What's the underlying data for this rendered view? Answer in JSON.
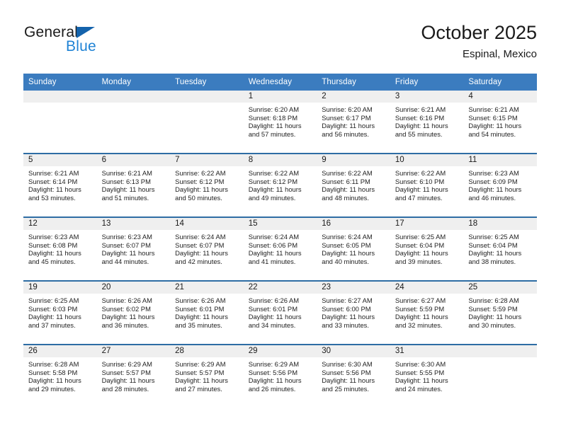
{
  "brand": {
    "name_part1": "General",
    "name_part2": "Blue",
    "triangle_color": "#1463ac",
    "blue_color": "#2083d5"
  },
  "header": {
    "title": "October 2025",
    "location": "Espinal, Mexico"
  },
  "theme": {
    "header_bg": "#3b7cbf",
    "row_divider": "#2e6da4",
    "daynum_bg": "#efefef"
  },
  "weekdays": [
    "Sunday",
    "Monday",
    "Tuesday",
    "Wednesday",
    "Thursday",
    "Friday",
    "Saturday"
  ],
  "weeks": [
    [
      {
        "day": "",
        "sunrise": "",
        "sunset": "",
        "daylight1": "",
        "daylight2": ""
      },
      {
        "day": "",
        "sunrise": "",
        "sunset": "",
        "daylight1": "",
        "daylight2": ""
      },
      {
        "day": "",
        "sunrise": "",
        "sunset": "",
        "daylight1": "",
        "daylight2": ""
      },
      {
        "day": "1",
        "sunrise": "Sunrise: 6:20 AM",
        "sunset": "Sunset: 6:18 PM",
        "daylight1": "Daylight: 11 hours",
        "daylight2": "and 57 minutes."
      },
      {
        "day": "2",
        "sunrise": "Sunrise: 6:20 AM",
        "sunset": "Sunset: 6:17 PM",
        "daylight1": "Daylight: 11 hours",
        "daylight2": "and 56 minutes."
      },
      {
        "day": "3",
        "sunrise": "Sunrise: 6:21 AM",
        "sunset": "Sunset: 6:16 PM",
        "daylight1": "Daylight: 11 hours",
        "daylight2": "and 55 minutes."
      },
      {
        "day": "4",
        "sunrise": "Sunrise: 6:21 AM",
        "sunset": "Sunset: 6:15 PM",
        "daylight1": "Daylight: 11 hours",
        "daylight2": "and 54 minutes."
      }
    ],
    [
      {
        "day": "5",
        "sunrise": "Sunrise: 6:21 AM",
        "sunset": "Sunset: 6:14 PM",
        "daylight1": "Daylight: 11 hours",
        "daylight2": "and 53 minutes."
      },
      {
        "day": "6",
        "sunrise": "Sunrise: 6:21 AM",
        "sunset": "Sunset: 6:13 PM",
        "daylight1": "Daylight: 11 hours",
        "daylight2": "and 51 minutes."
      },
      {
        "day": "7",
        "sunrise": "Sunrise: 6:22 AM",
        "sunset": "Sunset: 6:12 PM",
        "daylight1": "Daylight: 11 hours",
        "daylight2": "and 50 minutes."
      },
      {
        "day": "8",
        "sunrise": "Sunrise: 6:22 AM",
        "sunset": "Sunset: 6:12 PM",
        "daylight1": "Daylight: 11 hours",
        "daylight2": "and 49 minutes."
      },
      {
        "day": "9",
        "sunrise": "Sunrise: 6:22 AM",
        "sunset": "Sunset: 6:11 PM",
        "daylight1": "Daylight: 11 hours",
        "daylight2": "and 48 minutes."
      },
      {
        "day": "10",
        "sunrise": "Sunrise: 6:22 AM",
        "sunset": "Sunset: 6:10 PM",
        "daylight1": "Daylight: 11 hours",
        "daylight2": "and 47 minutes."
      },
      {
        "day": "11",
        "sunrise": "Sunrise: 6:23 AM",
        "sunset": "Sunset: 6:09 PM",
        "daylight1": "Daylight: 11 hours",
        "daylight2": "and 46 minutes."
      }
    ],
    [
      {
        "day": "12",
        "sunrise": "Sunrise: 6:23 AM",
        "sunset": "Sunset: 6:08 PM",
        "daylight1": "Daylight: 11 hours",
        "daylight2": "and 45 minutes."
      },
      {
        "day": "13",
        "sunrise": "Sunrise: 6:23 AM",
        "sunset": "Sunset: 6:07 PM",
        "daylight1": "Daylight: 11 hours",
        "daylight2": "and 44 minutes."
      },
      {
        "day": "14",
        "sunrise": "Sunrise: 6:24 AM",
        "sunset": "Sunset: 6:07 PM",
        "daylight1": "Daylight: 11 hours",
        "daylight2": "and 42 minutes."
      },
      {
        "day": "15",
        "sunrise": "Sunrise: 6:24 AM",
        "sunset": "Sunset: 6:06 PM",
        "daylight1": "Daylight: 11 hours",
        "daylight2": "and 41 minutes."
      },
      {
        "day": "16",
        "sunrise": "Sunrise: 6:24 AM",
        "sunset": "Sunset: 6:05 PM",
        "daylight1": "Daylight: 11 hours",
        "daylight2": "and 40 minutes."
      },
      {
        "day": "17",
        "sunrise": "Sunrise: 6:25 AM",
        "sunset": "Sunset: 6:04 PM",
        "daylight1": "Daylight: 11 hours",
        "daylight2": "and 39 minutes."
      },
      {
        "day": "18",
        "sunrise": "Sunrise: 6:25 AM",
        "sunset": "Sunset: 6:04 PM",
        "daylight1": "Daylight: 11 hours",
        "daylight2": "and 38 minutes."
      }
    ],
    [
      {
        "day": "19",
        "sunrise": "Sunrise: 6:25 AM",
        "sunset": "Sunset: 6:03 PM",
        "daylight1": "Daylight: 11 hours",
        "daylight2": "and 37 minutes."
      },
      {
        "day": "20",
        "sunrise": "Sunrise: 6:26 AM",
        "sunset": "Sunset: 6:02 PM",
        "daylight1": "Daylight: 11 hours",
        "daylight2": "and 36 minutes."
      },
      {
        "day": "21",
        "sunrise": "Sunrise: 6:26 AM",
        "sunset": "Sunset: 6:01 PM",
        "daylight1": "Daylight: 11 hours",
        "daylight2": "and 35 minutes."
      },
      {
        "day": "22",
        "sunrise": "Sunrise: 6:26 AM",
        "sunset": "Sunset: 6:01 PM",
        "daylight1": "Daylight: 11 hours",
        "daylight2": "and 34 minutes."
      },
      {
        "day": "23",
        "sunrise": "Sunrise: 6:27 AM",
        "sunset": "Sunset: 6:00 PM",
        "daylight1": "Daylight: 11 hours",
        "daylight2": "and 33 minutes."
      },
      {
        "day": "24",
        "sunrise": "Sunrise: 6:27 AM",
        "sunset": "Sunset: 5:59 PM",
        "daylight1": "Daylight: 11 hours",
        "daylight2": "and 32 minutes."
      },
      {
        "day": "25",
        "sunrise": "Sunrise: 6:28 AM",
        "sunset": "Sunset: 5:59 PM",
        "daylight1": "Daylight: 11 hours",
        "daylight2": "and 30 minutes."
      }
    ],
    [
      {
        "day": "26",
        "sunrise": "Sunrise: 6:28 AM",
        "sunset": "Sunset: 5:58 PM",
        "daylight1": "Daylight: 11 hours",
        "daylight2": "and 29 minutes."
      },
      {
        "day": "27",
        "sunrise": "Sunrise: 6:29 AM",
        "sunset": "Sunset: 5:57 PM",
        "daylight1": "Daylight: 11 hours",
        "daylight2": "and 28 minutes."
      },
      {
        "day": "28",
        "sunrise": "Sunrise: 6:29 AM",
        "sunset": "Sunset: 5:57 PM",
        "daylight1": "Daylight: 11 hours",
        "daylight2": "and 27 minutes."
      },
      {
        "day": "29",
        "sunrise": "Sunrise: 6:29 AM",
        "sunset": "Sunset: 5:56 PM",
        "daylight1": "Daylight: 11 hours",
        "daylight2": "and 26 minutes."
      },
      {
        "day": "30",
        "sunrise": "Sunrise: 6:30 AM",
        "sunset": "Sunset: 5:56 PM",
        "daylight1": "Daylight: 11 hours",
        "daylight2": "and 25 minutes."
      },
      {
        "day": "31",
        "sunrise": "Sunrise: 6:30 AM",
        "sunset": "Sunset: 5:55 PM",
        "daylight1": "Daylight: 11 hours",
        "daylight2": "and 24 minutes."
      },
      {
        "day": "",
        "sunrise": "",
        "sunset": "",
        "daylight1": "",
        "daylight2": ""
      }
    ]
  ]
}
